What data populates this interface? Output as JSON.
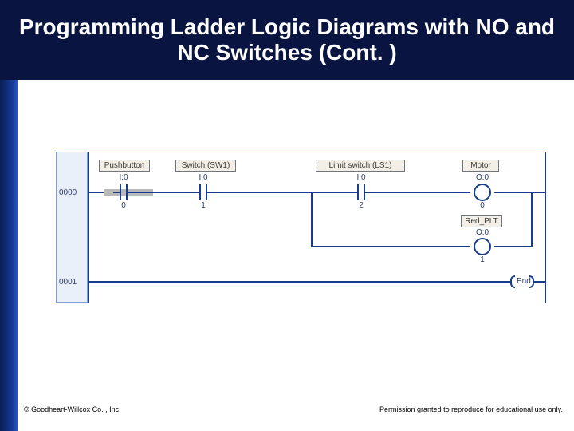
{
  "title": "Programming Ladder Logic Diagrams with NO and NC Switches (Cont. )",
  "rungs": {
    "r0": "0000",
    "r1": "0001"
  },
  "elements": {
    "pb": {
      "desc": "Pushbutton",
      "addr": "I:0",
      "bit": "0"
    },
    "sw1": {
      "desc": "Switch (SW1)",
      "addr": "I:0",
      "bit": "1"
    },
    "ls1": {
      "desc": "Limit switch (LS1)",
      "addr": "I:0",
      "bit": "2"
    },
    "motor": {
      "desc": "Motor",
      "addr": "O:0",
      "bit": "0"
    },
    "red": {
      "desc": "Red_PLT",
      "addr": "O:0",
      "bit": "1"
    }
  },
  "end_label": "End",
  "footer": {
    "copyright": "© Goodheart-Willcox Co. , Inc.",
    "permission": "Permission granted to reproduce for educational use only."
  }
}
